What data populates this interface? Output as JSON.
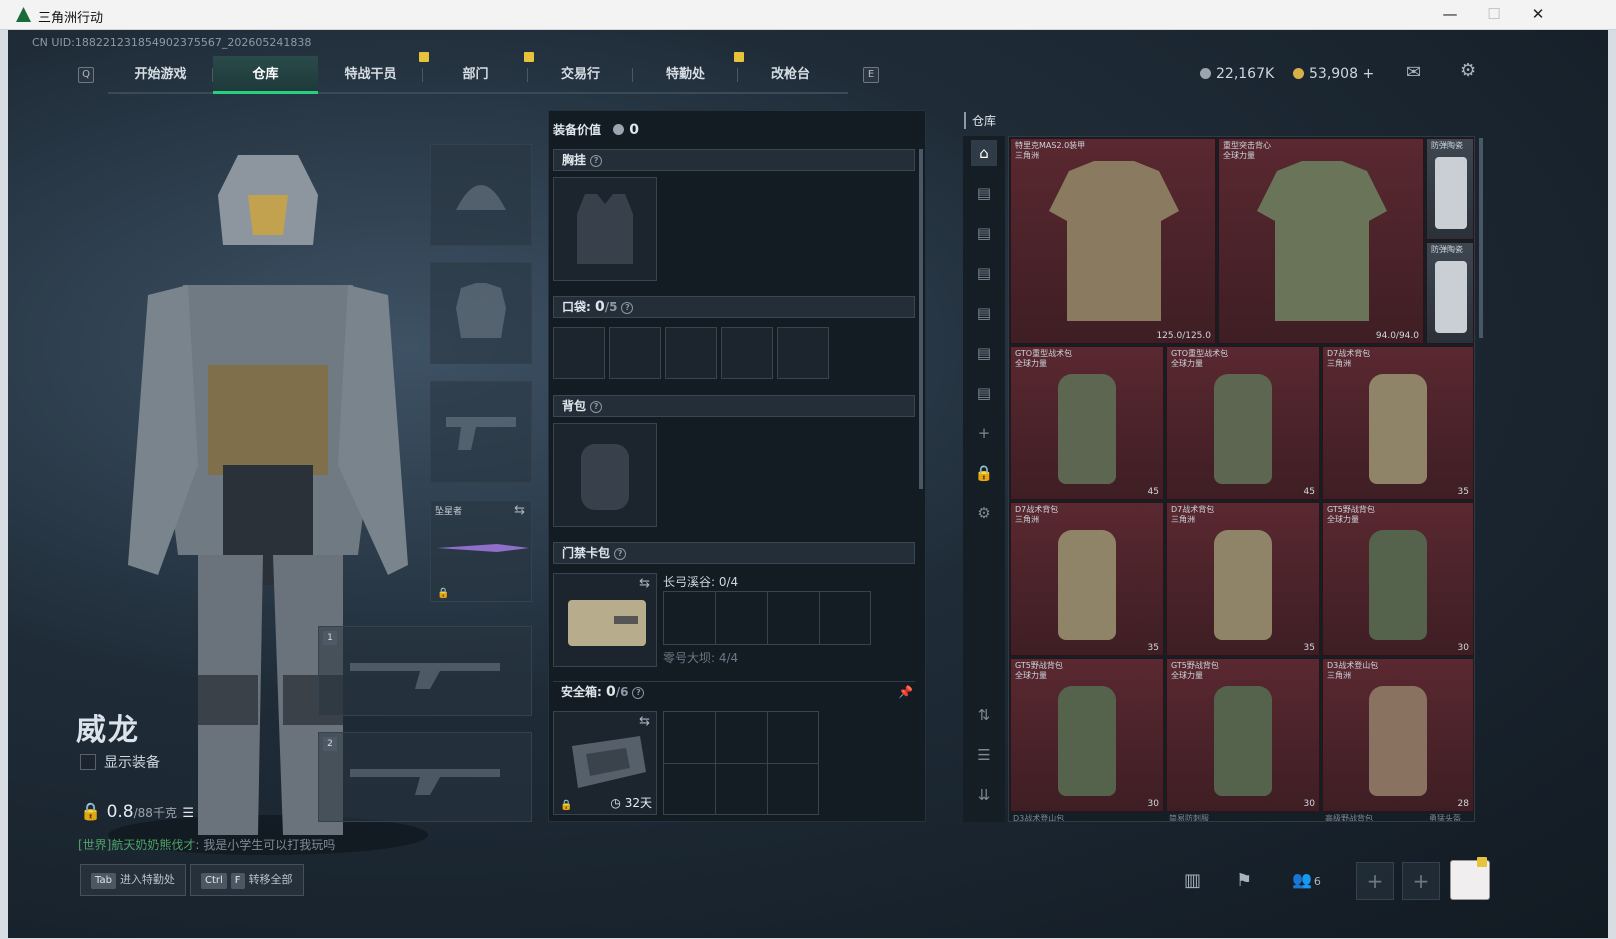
{
  "window": {
    "title": "三角洲行动",
    "minimize": "—",
    "maximize": "☐",
    "close": "✕"
  },
  "uid": "CN UID:1882212318549023755​67_202605241838",
  "nav": {
    "key_left": "Q",
    "key_right": "E",
    "tabs": [
      {
        "label": "开始游戏"
      },
      {
        "label": "仓库",
        "active": true
      },
      {
        "label": "特战干员"
      },
      {
        "label": "部门"
      },
      {
        "label": "交易行"
      },
      {
        "label": "特勤处"
      },
      {
        "label": "改枪台"
      }
    ]
  },
  "currency": {
    "silver": "22,167K",
    "gold": "53,908",
    "gold_plus": "+"
  },
  "character": {
    "name": "威龙",
    "show_equipment": "显示装备",
    "weight": "0.8",
    "weight_unit": "/88千克"
  },
  "chat": {
    "channel": "[世界]",
    "user": "航天奶奶熊伐才",
    "text": "我是小学生可以打我玩吗"
  },
  "bottom": {
    "enter_key": "Tab",
    "enter_label": "进入特勤处",
    "transfer_keys": [
      "Ctrl",
      "F"
    ],
    "transfer_label": "转移全部",
    "friends": "6"
  },
  "equipment": {
    "melee_label": "坠星者",
    "slot1": "1",
    "slot2": "2"
  },
  "loadout": {
    "value_label": "装备价值",
    "value": "0",
    "chest_label": "胸挂",
    "pocket_label": "口袋:",
    "pocket_count": "0",
    "pocket_max": "/5",
    "backpack_label": "背包",
    "keycard_label": "门禁卡包",
    "keycard_map1": "长弓溪谷: 0/4",
    "keycard_map2": "零号大坝: 4/4",
    "safe_label": "安全箱:",
    "safe_count": "0",
    "safe_max": "/6",
    "safe_days": "32天"
  },
  "warehouse": {
    "title": "仓库",
    "items": [
      {
        "name": "特里克MAS2.0装甲\n三角洲",
        "qty": "125.0/125.0"
      },
      {
        "name": "重型突击背心\n全球力量",
        "qty": "94.0/94.0"
      },
      {
        "name": "防弹陶瓷",
        "qty": ""
      },
      {
        "name": "防弹陶瓷",
        "qty": ""
      },
      {
        "name": "GTO重型战术包\n全球力量",
        "qty": "45"
      },
      {
        "name": "GTO重型战术包\n全球力量",
        "qty": "45"
      },
      {
        "name": "D7战术背包\n三角洲",
        "qty": "35"
      },
      {
        "name": "D7战术背包\n三角洲",
        "qty": "35"
      },
      {
        "name": "D7战术背包\n三角洲",
        "qty": "35"
      },
      {
        "name": "GT5野战背包\n全球力量",
        "qty": "30"
      },
      {
        "name": "GT5野战背包\n全球力量",
        "qty": "30"
      },
      {
        "name": "GT5野战背包\n全球力量",
        "qty": "30"
      },
      {
        "name": "D3战术登山包\n三角洲",
        "qty": "28"
      }
    ],
    "partial": [
      "D3战术登山包",
      "简易防刺服",
      "高级野战背包",
      "勇猛头盔"
    ]
  }
}
